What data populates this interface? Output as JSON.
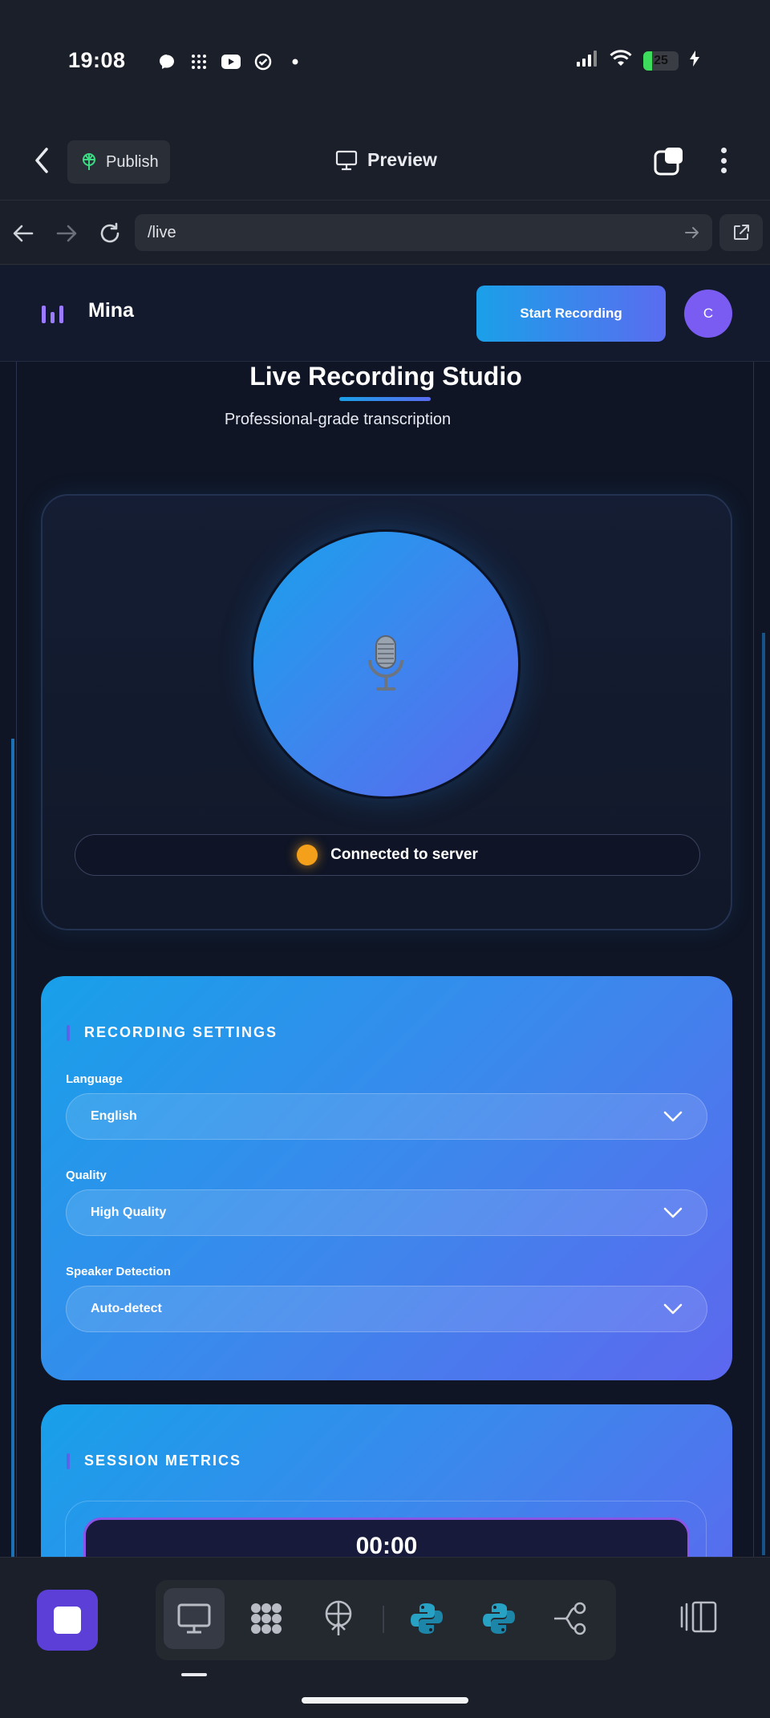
{
  "status_bar": {
    "time": "19:08",
    "battery": "25",
    "battery_level": 0.25,
    "notification_icons": [
      "messenger-icon",
      "grid-dots-icon",
      "youtube-icon",
      "check-circle-icon",
      "dot-icon"
    ],
    "right_icons": [
      "signal-icon",
      "wifi-icon",
      "battery-icon",
      "charging-icon"
    ]
  },
  "app_bar": {
    "publish_label": "Publish",
    "preview_label": "Preview"
  },
  "url_bar": {
    "url": "/live"
  },
  "site": {
    "brand": "Mina",
    "start_recording": "Start Recording",
    "avatar_initial": "C",
    "title": "Live Recording Studio",
    "subtitle": "Professional-grade transcription",
    "mic_emoji": "🎙️",
    "status_text": "Connected to server",
    "status_color": "#f5a01a"
  },
  "settings": {
    "heading": "RECORDING SETTINGS",
    "fields": [
      {
        "label": "Language",
        "value": "English"
      },
      {
        "label": "Quality",
        "value": "High Quality"
      },
      {
        "label": "Speaker Detection",
        "value": "Auto-detect"
      }
    ]
  },
  "metrics": {
    "heading": "SESSION METRICS",
    "timer": "00:00"
  },
  "colors": {
    "accent_start": "#1aa0e8",
    "accent_end": "#5a6cf0",
    "stop_button": "#5b3fd6"
  },
  "dock": {
    "tools": [
      "desktop-icon",
      "grid-cluster-icon",
      "deploy-icon",
      "python-icon",
      "python-icon",
      "workflow-icon"
    ]
  }
}
